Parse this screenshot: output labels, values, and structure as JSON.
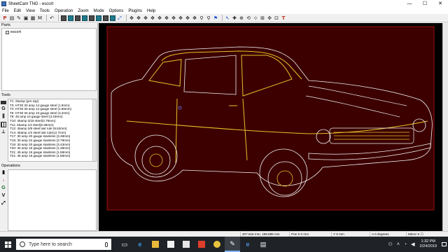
{
  "window": {
    "title": "SheetCam TNG - escort",
    "minimize": "—",
    "maximize": "☐",
    "close": "✕"
  },
  "menu": [
    "File",
    "Edit",
    "View",
    "Tools",
    "Operation",
    "Zoom",
    "Mode",
    "Options",
    "Plugins",
    "Help"
  ],
  "parts_panel": {
    "title": "Parts",
    "items": [
      {
        "label": "escort",
        "checked": true
      }
    ]
  },
  "tools_panel": {
    "title": "Tools",
    "items": [
      "T1: 25amp (pre ssp)",
      "T3: HT30 30 amp 14 gauge steel (1.9mm)",
      "T4: HT30 30 amp 12 gauge steel (2.66mm)",
      "T6: HT30 30 amp 10 gauge steel (3.4mm)",
      "T9: 45 amp 10 gauge steel (3.43mm)",
      "T10: 45amp 3/16 steel(4.76mm)",
      "T11: 45amp 1/4 steel(6.35mm)",
      "T12: 45amp 3/8 steel last rule (9.52mm)",
      "T14: 45amp 1/2 steel last rule(12.7mm)",
      "T17: 30 amp 20 gauge stainless (3.48mm)",
      "T18: 30 amp 22 gauge stainless (3.79mm)",
      "T19: 30 amp 20 gauge stainless (3.43mm)",
      "T20: 30 amp 18 gauge stainless (1.39mm)",
      "T21: 45 amp 16 gauge stainless (1.58mm)",
      "T21: 45 amp 16 gauge stainless (1.58mm)"
    ]
  },
  "operations_panel": {
    "title": "Operations"
  },
  "status": {
    "coords": "207.618 mm, 198.889 mm",
    "pos_x": "Pos X 0 mm",
    "y": "Y 0 mm",
    "a": "A 0 degrees",
    "mirror": "Mirror X ☐"
  },
  "taskbar": {
    "search_placeholder": "Type here to search",
    "time": "1:32 PM",
    "date": "2/24/2019"
  },
  "colors": {
    "canvas": "#000000",
    "sheet": "#3c0000",
    "sheet_edge": "#a01010",
    "outline_yellow": "#e6c22a",
    "outline_white": "#f2f2f2"
  }
}
